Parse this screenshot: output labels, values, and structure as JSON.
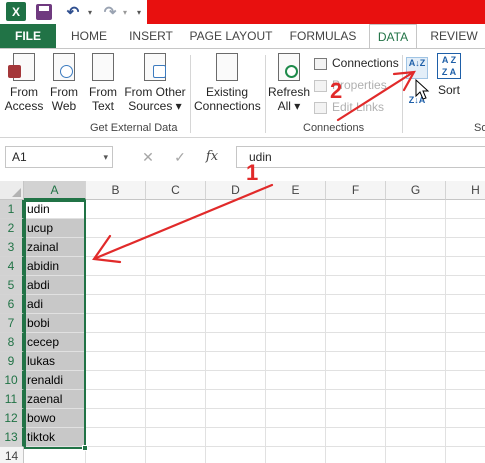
{
  "qat": {
    "app_logo": "X",
    "icons": [
      "excel-icon",
      "save-icon",
      "undo-icon",
      "redo-icon"
    ]
  },
  "tabs": [
    {
      "label": "FILE"
    },
    {
      "label": "HOME"
    },
    {
      "label": "INSERT"
    },
    {
      "label": "PAGE LAYOUT"
    },
    {
      "label": "FORMULAS"
    },
    {
      "label": "DATA",
      "active": true
    },
    {
      "label": "REVIEW"
    }
  ],
  "ribbon": {
    "get_external_data": {
      "label": "Get External Data",
      "buttons": [
        {
          "line1": "From",
          "line2": "Access",
          "icon": "access-db-icon"
        },
        {
          "line1": "From",
          "line2": "Web",
          "icon": "web-globe-icon"
        },
        {
          "line1": "From",
          "line2": "Text",
          "icon": "text-file-icon"
        },
        {
          "line1": "From Other",
          "line2": "Sources ▾",
          "icon": "other-sources-icon"
        },
        {
          "line1": "Existing",
          "line2": "Connections",
          "icon": "existing-connections-icon"
        }
      ]
    },
    "connections": {
      "label": "Connections",
      "refresh_line1": "Refresh",
      "refresh_line2": "All ▾",
      "connections_label": "Connections",
      "properties_label": "Properties",
      "edit_links_label": "Edit Links"
    },
    "sort_filter": {
      "sort_label": "Sort",
      "group_label_fragment": "So",
      "sort_az_glyph": "A↓Z",
      "sort_za_glyph": "Z↓A",
      "sort_dialog_glyph_top": "A Z",
      "sort_dialog_glyph_bottom": "Z A"
    }
  },
  "formula_bar": {
    "name_box": "A1",
    "cancel": "✕",
    "enter": "✓",
    "fx": "fx",
    "value": "udin"
  },
  "sheet": {
    "columns": [
      "A",
      "B",
      "C",
      "D",
      "E",
      "F",
      "G",
      "H"
    ],
    "rows": [
      "1",
      "2",
      "3",
      "4",
      "5",
      "6",
      "7",
      "8",
      "9",
      "10",
      "11",
      "12",
      "13",
      "14"
    ],
    "column_a_values": [
      "udin",
      "ucup",
      "zainal",
      "abidin",
      "abdi",
      "adi",
      "bobi",
      "cecep",
      "lukas",
      "renaldi",
      "zaenal",
      "bowo",
      "tiktok",
      ""
    ]
  },
  "annotations": {
    "step1": "1",
    "step2": "2",
    "color": "#e12a2a"
  },
  "colors": {
    "excel_green": "#217346",
    "title_red": "#e8100f",
    "selection_gray": "#c8c8c8"
  }
}
